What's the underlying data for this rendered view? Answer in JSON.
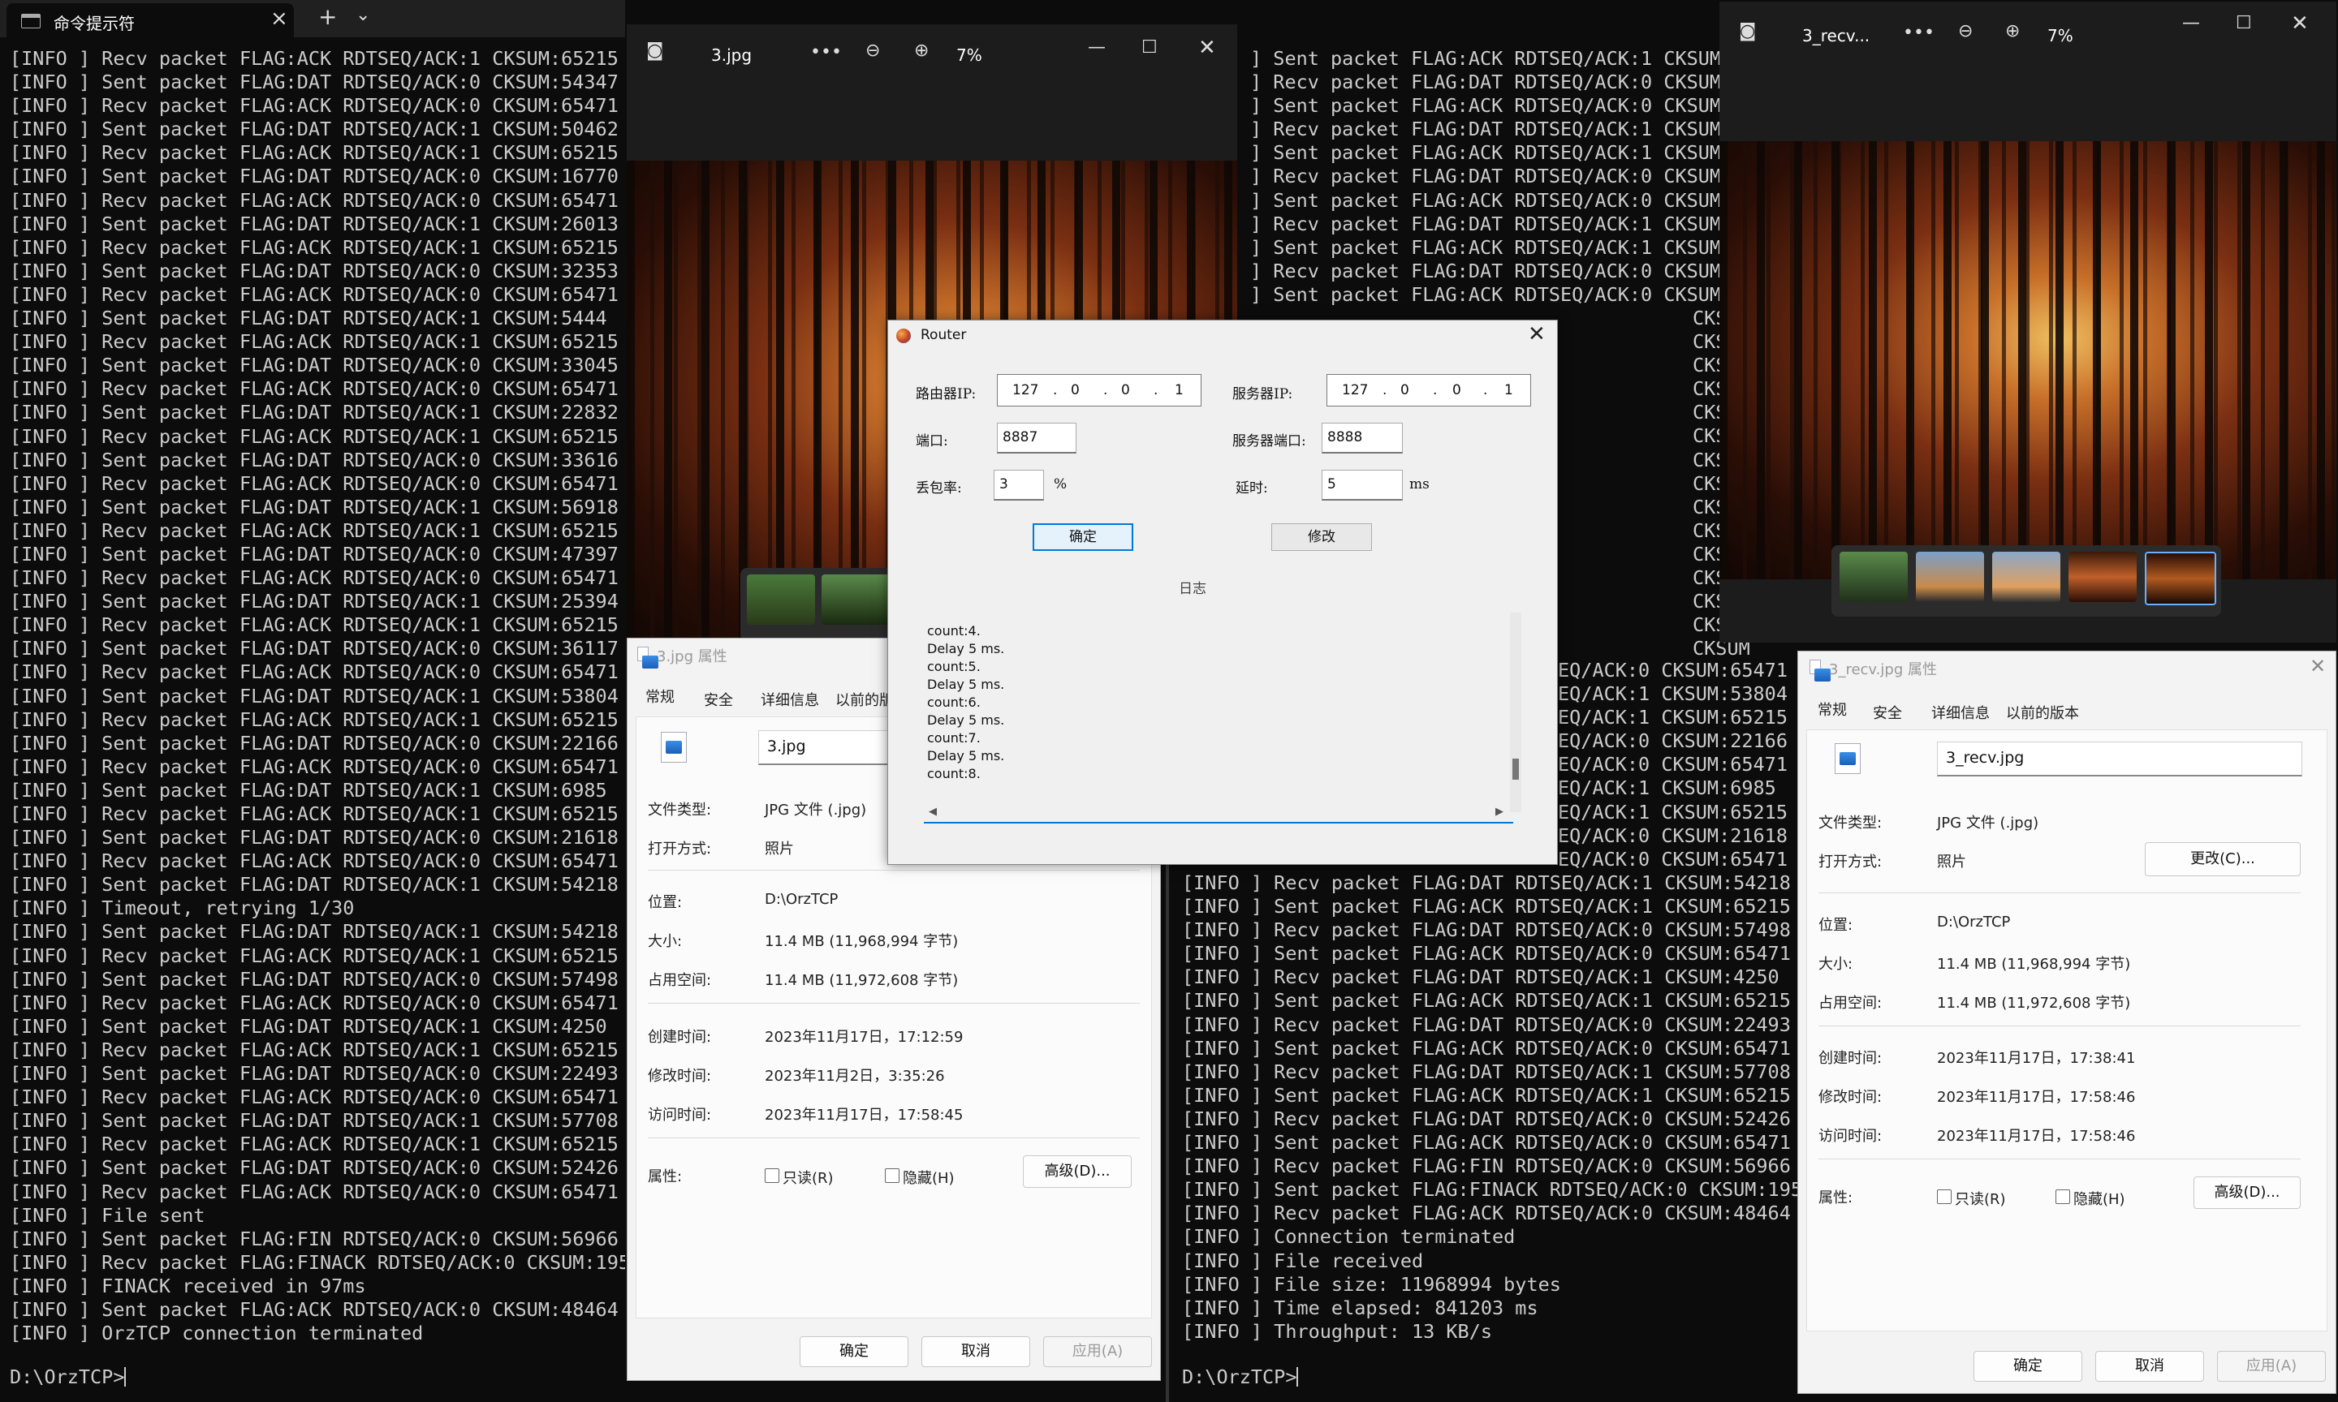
{
  "left_terminal": {
    "tab_title": "命令提示符",
    "lines": [
      "[INFO ] Recv packet FLAG:ACK RDTSEQ/ACK:1 CKSUM:65215",
      "[INFO ] Sent packet FLAG:DAT RDTSEQ/ACK:0 CKSUM:54347",
      "[INFO ] Recv packet FLAG:ACK RDTSEQ/ACK:0 CKSUM:65471",
      "[INFO ] Sent packet FLAG:DAT RDTSEQ/ACK:1 CKSUM:50462",
      "[INFO ] Recv packet FLAG:ACK RDTSEQ/ACK:1 CKSUM:65215",
      "[INFO ] Sent packet FLAG:DAT RDTSEQ/ACK:0 CKSUM:16770",
      "[INFO ] Recv packet FLAG:ACK RDTSEQ/ACK:0 CKSUM:65471",
      "[INFO ] Sent packet FLAG:DAT RDTSEQ/ACK:1 CKSUM:26013",
      "[INFO ] Recv packet FLAG:ACK RDTSEQ/ACK:1 CKSUM:65215",
      "[INFO ] Sent packet FLAG:DAT RDTSEQ/ACK:0 CKSUM:32353",
      "[INFO ] Recv packet FLAG:ACK RDTSEQ/ACK:0 CKSUM:65471",
      "[INFO ] Sent packet FLAG:DAT RDTSEQ/ACK:1 CKSUM:5444",
      "[INFO ] Recv packet FLAG:ACK RDTSEQ/ACK:1 CKSUM:65215",
      "[INFO ] Sent packet FLAG:DAT RDTSEQ/ACK:0 CKSUM:33045",
      "[INFO ] Recv packet FLAG:ACK RDTSEQ/ACK:0 CKSUM:65471",
      "[INFO ] Sent packet FLAG:DAT RDTSEQ/ACK:1 CKSUM:22832",
      "[INFO ] Recv packet FLAG:ACK RDTSEQ/ACK:1 CKSUM:65215",
      "[INFO ] Sent packet FLAG:DAT RDTSEQ/ACK:0 CKSUM:33616",
      "[INFO ] Recv packet FLAG:ACK RDTSEQ/ACK:0 CKSUM:65471",
      "[INFO ] Sent packet FLAG:DAT RDTSEQ/ACK:1 CKSUM:56918",
      "[INFO ] Recv packet FLAG:ACK RDTSEQ/ACK:1 CKSUM:65215",
      "[INFO ] Sent packet FLAG:DAT RDTSEQ/ACK:0 CKSUM:47397",
      "[INFO ] Recv packet FLAG:ACK RDTSEQ/ACK:0 CKSUM:65471",
      "[INFO ] Sent packet FLAG:DAT RDTSEQ/ACK:1 CKSUM:25394",
      "[INFO ] Recv packet FLAG:ACK RDTSEQ/ACK:1 CKSUM:65215",
      "[INFO ] Sent packet FLAG:DAT RDTSEQ/ACK:0 CKSUM:36117",
      "[INFO ] Recv packet FLAG:ACK RDTSEQ/ACK:0 CKSUM:65471",
      "[INFO ] Sent packet FLAG:DAT RDTSEQ/ACK:1 CKSUM:53804",
      "[INFO ] Recv packet FLAG:ACK RDTSEQ/ACK:1 CKSUM:65215",
      "[INFO ] Sent packet FLAG:DAT RDTSEQ/ACK:0 CKSUM:22166",
      "[INFO ] Recv packet FLAG:ACK RDTSEQ/ACK:0 CKSUM:65471",
      "[INFO ] Sent packet FLAG:DAT RDTSEQ/ACK:1 CKSUM:6985",
      "[INFO ] Recv packet FLAG:ACK RDTSEQ/ACK:1 CKSUM:65215",
      "[INFO ] Sent packet FLAG:DAT RDTSEQ/ACK:0 CKSUM:21618",
      "[INFO ] Recv packet FLAG:ACK RDTSEQ/ACK:0 CKSUM:65471",
      "[INFO ] Sent packet FLAG:DAT RDTSEQ/ACK:1 CKSUM:54218",
      "[INFO ] Timeout, retrying 1/30",
      "[INFO ] Sent packet FLAG:DAT RDTSEQ/ACK:1 CKSUM:54218",
      "[INFO ] Recv packet FLAG:ACK RDTSEQ/ACK:1 CKSUM:65215",
      "[INFO ] Sent packet FLAG:DAT RDTSEQ/ACK:0 CKSUM:57498",
      "[INFO ] Recv packet FLAG:ACK RDTSEQ/ACK:0 CKSUM:65471",
      "[INFO ] Sent packet FLAG:DAT RDTSEQ/ACK:1 CKSUM:4250",
      "[INFO ] Recv packet FLAG:ACK RDTSEQ/ACK:1 CKSUM:65215",
      "[INFO ] Sent packet FLAG:DAT RDTSEQ/ACK:0 CKSUM:22493",
      "[INFO ] Recv packet FLAG:ACK RDTSEQ/ACK:0 CKSUM:65471",
      "[INFO ] Sent packet FLAG:DAT RDTSEQ/ACK:1 CKSUM:57708",
      "[INFO ] Recv packet FLAG:ACK RDTSEQ/ACK:1 CKSUM:65215",
      "[INFO ] Sent packet FLAG:DAT RDTSEQ/ACK:0 CKSUM:52426",
      "[INFO ] Recv packet FLAG:ACK RDTSEQ/ACK:0 CKSUM:65471",
      "[INFO ] File sent",
      "[INFO ] Sent packet FLAG:FIN RDTSEQ/ACK:0 CKSUM:56966",
      "[INFO ] Recv packet FLAG:FINACK RDTSEQ/ACK:0 CKSUM:195",
      "[INFO ] FINACK received in 97ms",
      "[INFO ] Sent packet FLAG:ACK RDTSEQ/ACK:0 CKSUM:48464",
      "[INFO ] OrzTCP connection terminated"
    ],
    "prompt": "D:\\OrzTCP>"
  },
  "right_terminal": {
    "upper_lines": [
      "] Sent packet FLAG:ACK RDTSEQ/ACK:1 CKSUM",
      "] Recv packet FLAG:DAT RDTSEQ/ACK:0 CKSUM",
      "] Sent packet FLAG:ACK RDTSEQ/ACK:0 CKSUM",
      "] Recv packet FLAG:DAT RDTSEQ/ACK:1 CKSUM",
      "] Sent packet FLAG:ACK RDTSEQ/ACK:1 CKSUM",
      "] Recv packet FLAG:DAT RDTSEQ/ACK:0 CKSUM",
      "] Sent packet FLAG:ACK RDTSEQ/ACK:0 CKSUM",
      "] Recv packet FLAG:DAT RDTSEQ/ACK:1 CKSUM",
      "] Sent packet FLAG:ACK RDTSEQ/ACK:1 CKSUM",
      "] Recv packet FLAG:DAT RDTSEQ/ACK:0 CKSUM",
      "] Sent packet FLAG:ACK RDTSEQ/ACK:0 CKSUM"
    ],
    "side_fragments": [
      "CKSUM",
      "CKSUM",
      "CKSUM",
      "CKSUM",
      "CKSUM",
      "CKSUM",
      "CKSUM",
      "CKSUM",
      "CKSUM",
      "CKSUM",
      "CKSUM",
      "CKSUM",
      "CKSUM",
      "CKSUM",
      "CKSUM"
    ],
    "mid_fragments": [
      "EQ/ACK:0 CKSUM:65471",
      "EQ/ACK:1 CKSUM:53804",
      "EQ/ACK:1 CKSUM:65215",
      "EQ/ACK:0 CKSUM:22166",
      "EQ/ACK:0 CKSUM:65471",
      "EQ/ACK:1 CKSUM:6985",
      "EQ/ACK:1 CKSUM:65215",
      "EQ/ACK:0 CKSUM:21618",
      "EQ/ACK:0 CKSUM:65471"
    ],
    "lines": [
      "[INFO ] Recv packet FLAG:DAT RDTSEQ/ACK:1 CKSUM:54218",
      "[INFO ] Sent packet FLAG:ACK RDTSEQ/ACK:1 CKSUM:65215",
      "[INFO ] Recv packet FLAG:DAT RDTSEQ/ACK:0 CKSUM:57498",
      "[INFO ] Sent packet FLAG:ACK RDTSEQ/ACK:0 CKSUM:65471",
      "[INFO ] Recv packet FLAG:DAT RDTSEQ/ACK:1 CKSUM:4250",
      "[INFO ] Sent packet FLAG:ACK RDTSEQ/ACK:1 CKSUM:65215",
      "[INFO ] Recv packet FLAG:DAT RDTSEQ/ACK:0 CKSUM:22493",
      "[INFO ] Sent packet FLAG:ACK RDTSEQ/ACK:0 CKSUM:65471",
      "[INFO ] Recv packet FLAG:DAT RDTSEQ/ACK:1 CKSUM:57708",
      "[INFO ] Sent packet FLAG:ACK RDTSEQ/ACK:1 CKSUM:65215",
      "[INFO ] Recv packet FLAG:DAT RDTSEQ/ACK:0 CKSUM:52426",
      "[INFO ] Sent packet FLAG:ACK RDTSEQ/ACK:0 CKSUM:65471",
      "[INFO ] Recv packet FLAG:FIN RDTSEQ/ACK:0 CKSUM:56966",
      "[INFO ] Sent packet FLAG:FINACK RDTSEQ/ACK:0 CKSUM:195",
      "[INFO ] Recv packet FLAG:ACK RDTSEQ/ACK:0 CKSUM:48464",
      "[INFO ] Connection terminated",
      "[INFO ] File received",
      "[INFO ] File size: 11968994 bytes",
      "[INFO ] Time elapsed: 841203 ms",
      "[INFO ] Throughput: 13 KB/s"
    ],
    "prompt": "D:\\OrzTCP>"
  },
  "viewer1": {
    "title": "3.jpg",
    "zoom": "7%"
  },
  "viewer2": {
    "title": "3_recv...",
    "zoom": "7%"
  },
  "props1": {
    "title": "3.jpg 属性",
    "tabs": [
      "常规",
      "安全",
      "详细信息",
      "以前的版"
    ],
    "filename": "3.jpg",
    "labels": {
      "type": "文件类型:",
      "open_with": "打开方式:",
      "location": "位置:",
      "size": "大小:",
      "disk_size": "占用空间:",
      "created": "创建时间:",
      "modified": "修改时间:",
      "accessed": "访问时间:",
      "attributes": "属性:"
    },
    "values": {
      "type": "JPG 文件 (.jpg)",
      "open_with": "照片",
      "location": "D:\\OrzTCP",
      "size": "11.4 MB (11,968,994 字节)",
      "disk_size": "11.4 MB (11,972,608 字节)",
      "created": "2023年11月17日，17:12:59",
      "modified": "2023年11月2日，3:35:26",
      "accessed": "2023年11月17日，17:58:45"
    },
    "readonly": "只读(R)",
    "hidden": "隐藏(H)",
    "advanced": "高级(D)...",
    "ok": "确定",
    "cancel": "取消",
    "apply": "应用(A)"
  },
  "props2": {
    "title": "3_recv.jpg 属性",
    "tabs": [
      "常规",
      "安全",
      "详细信息",
      "以前的版本"
    ],
    "filename": "3_recv.jpg",
    "labels": {
      "type": "文件类型:",
      "open_with": "打开方式:",
      "location": "位置:",
      "size": "大小:",
      "disk_size": "占用空间:",
      "created": "创建时间:",
      "modified": "修改时间:",
      "accessed": "访问时间:",
      "attributes": "属性:"
    },
    "values": {
      "type": "JPG 文件 (.jpg)",
      "open_with": "照片",
      "location": "D:\\OrzTCP",
      "size": "11.4 MB (11,968,994 字节)",
      "disk_size": "11.4 MB (11,972,608 字节)",
      "created": "2023年11月17日，17:38:41",
      "modified": "2023年11月17日，17:58:46",
      "accessed": "2023年11月17日，17:58:46"
    },
    "change": "更改(C)...",
    "readonly": "只读(R)",
    "hidden": "隐藏(H)",
    "advanced": "高级(D)...",
    "ok": "确定",
    "cancel": "取消",
    "apply": "应用(A)"
  },
  "router": {
    "title": "Router",
    "router_ip_label": "路由器IP:",
    "router_ip": [
      "127",
      "0",
      "0",
      "1"
    ],
    "server_ip_label": "服务器IP:",
    "server_ip": [
      "127",
      "0",
      "0",
      "1"
    ],
    "port_label": "端口:",
    "port": "8887",
    "server_port_label": "服务器端口:",
    "server_port": "8888",
    "loss_label": "丢包率:",
    "loss": "3",
    "loss_unit": "%",
    "delay_label": "延时:",
    "delay": "5",
    "delay_unit": "ms",
    "confirm": "确定",
    "modify": "修改",
    "log_label": "日志",
    "log": [
      "count:4.",
      "Delay 5 ms.",
      "count:5.",
      "Delay 5 ms.",
      "count:6.",
      "Delay 5 ms.",
      "count:7.",
      "Delay 5 ms.",
      "count:8."
    ]
  },
  "colors": {
    "terminal_bg": "#0c0c0c",
    "terminal_fg": "#cccccc",
    "accent": "#0078d7"
  }
}
